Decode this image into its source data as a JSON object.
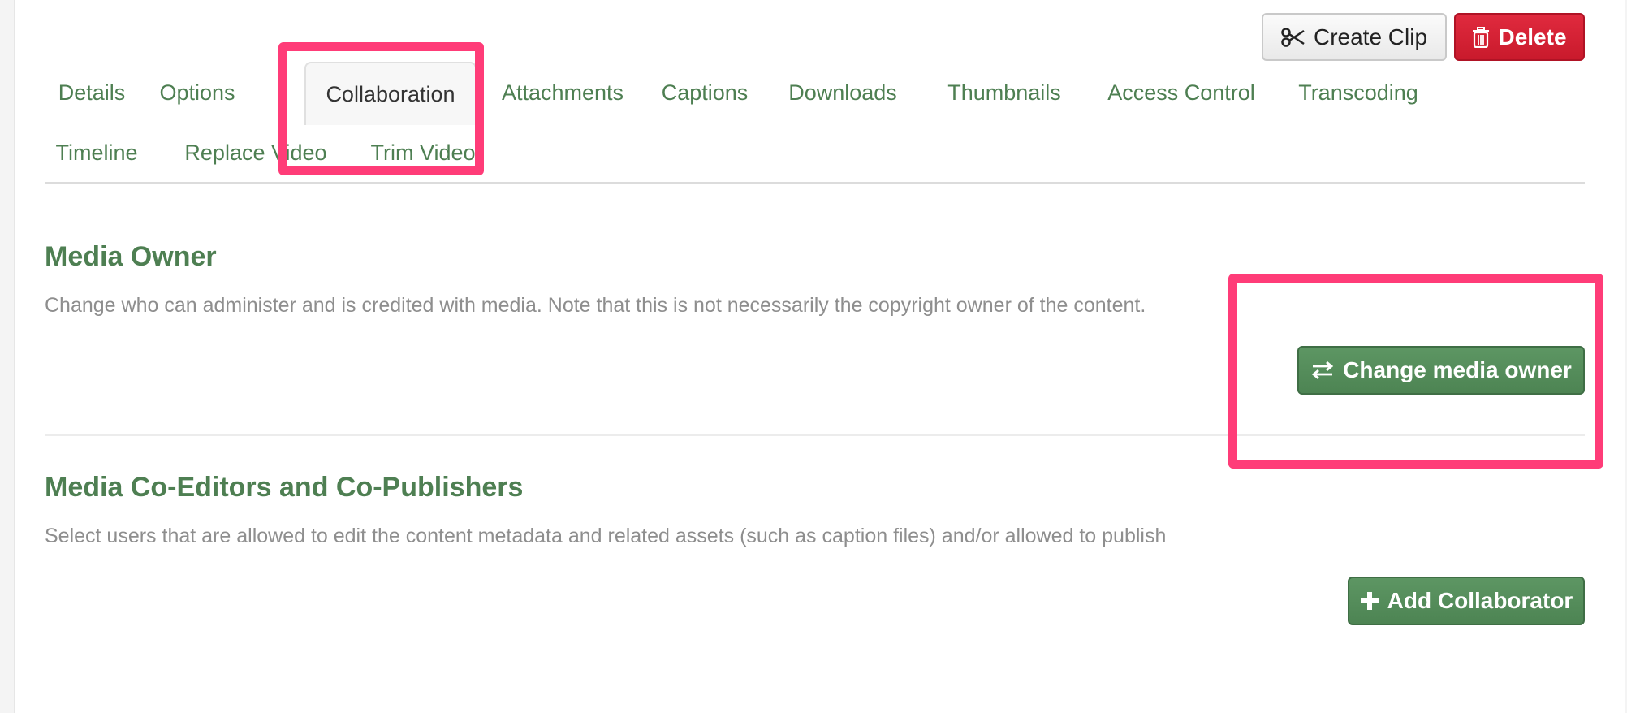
{
  "toolbar": {
    "create_clip_label": "Create Clip",
    "delete_label": "Delete"
  },
  "tabs": [
    {
      "label": "Details"
    },
    {
      "label": "Options"
    },
    {
      "label": "Collaboration",
      "active": true
    },
    {
      "label": "Attachments"
    },
    {
      "label": "Captions"
    },
    {
      "label": "Downloads"
    },
    {
      "label": "Thumbnails"
    },
    {
      "label": "Access Control"
    },
    {
      "label": "Transcoding"
    },
    {
      "label": "Timeline"
    },
    {
      "label": "Replace Video"
    },
    {
      "label": "Trim Video"
    }
  ],
  "media_owner": {
    "title": "Media Owner",
    "description": "Change who can administer and is credited with media. Note that this is not necessarily the copyright owner of the content.",
    "button_label": "Change media owner"
  },
  "co_editors": {
    "title": "Media Co-Editors and Co-Publishers",
    "description": "Select users that are allowed to edit the content metadata and related assets (such as caption files) and/or allowed to publish",
    "button_label": "Add Collaborator"
  },
  "colors": {
    "accent_green": "#4e7f52",
    "delete_red": "#d4213a",
    "highlight_pink": "#ff3c78"
  },
  "icons": {
    "create_clip": "scissors-icon",
    "delete": "trash-icon",
    "change_owner": "swap-arrows-icon",
    "add_collaborator": "plus-icon"
  }
}
